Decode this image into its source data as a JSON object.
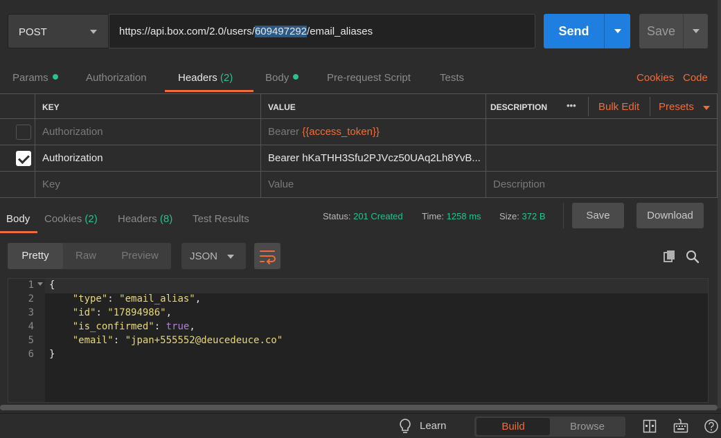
{
  "request": {
    "method": "POST",
    "url_prefix": "https://api.box.com/2.0/users/",
    "url_highlight": "609497292",
    "url_suffix": "/email_aliases",
    "send_label": "Send",
    "save_label": "Save"
  },
  "request_tabs": {
    "params": "Params",
    "authorization": "Authorization",
    "headers": "Headers",
    "headers_count": "(2)",
    "body": "Body",
    "prerequest": "Pre-request Script",
    "tests": "Tests",
    "cookies": "Cookies",
    "code": "Code"
  },
  "headers_table": {
    "col_key": "KEY",
    "col_value": "VALUE",
    "col_description": "DESCRIPTION",
    "more": "•••",
    "bulk_edit": "Bulk Edit",
    "presets": "Presets",
    "rows": [
      {
        "key": "Authorization",
        "value_prefix": "Bearer ",
        "value_var": "{{access_token}}",
        "value": "",
        "checked": false
      },
      {
        "key": "Authorization",
        "value_prefix": "",
        "value_var": "",
        "value": "Bearer hKaTHH3Sfu2PJVcz50UAq2Lh8YvB...",
        "checked": true
      }
    ],
    "placeholder": {
      "key": "Key",
      "value": "Value",
      "description": "Description"
    }
  },
  "response_tabs": {
    "body": "Body",
    "cookies": "Cookies",
    "cookies_count": "(2)",
    "headers": "Headers",
    "headers_count": "(8)",
    "test_results": "Test Results"
  },
  "response_status": {
    "status_label": "Status:",
    "status_value": "201 Created",
    "time_label": "Time:",
    "time_value": "1258 ms",
    "size_label": "Size:",
    "size_value": "372 B",
    "save": "Save",
    "download": "Download"
  },
  "viewer": {
    "pretty": "Pretty",
    "raw": "Raw",
    "preview": "Preview",
    "format": "JSON"
  },
  "code_lines": [
    {
      "n": "1",
      "text": "{"
    },
    {
      "n": "2",
      "key": "\"type\"",
      "val": "\"email_alias\"",
      "tail": ","
    },
    {
      "n": "3",
      "key": "\"id\"",
      "val": "\"17894986\"",
      "tail": ","
    },
    {
      "n": "4",
      "key": "\"is_confirmed\"",
      "val": "true",
      "tail": ","
    },
    {
      "n": "5",
      "key": "\"email\"",
      "val": "\"jpan+555552@deucedeuce.co\"",
      "tail": ""
    },
    {
      "n": "6",
      "text": "}"
    }
  ],
  "footer": {
    "learn": "Learn",
    "build": "Build",
    "browse": "Browse"
  }
}
